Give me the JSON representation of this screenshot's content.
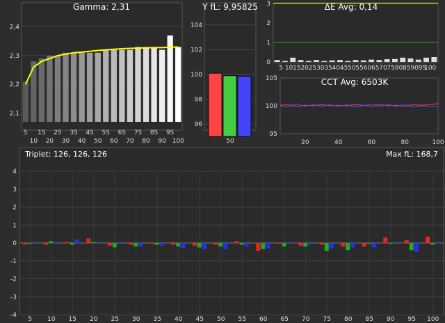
{
  "chart_data": [
    {
      "type": "bar",
      "title": "Gamma: 2,31",
      "categories": [
        5,
        10,
        15,
        20,
        25,
        30,
        35,
        40,
        45,
        50,
        55,
        60,
        65,
        70,
        75,
        80,
        85,
        90,
        95,
        100
      ],
      "x_tick_labels": [
        "5",
        "10",
        "15",
        "20",
        "25",
        "30",
        "35",
        "40",
        "45",
        "50",
        "55",
        "60",
        "65",
        "70",
        "75",
        "80",
        "85",
        "90",
        "95",
        "100"
      ],
      "y_tick_labels": [
        "2,4",
        "2,3",
        "2,2",
        "2,1"
      ],
      "y_ticks": [
        2.4,
        2.3,
        2.2,
        2.1
      ],
      "ylim": [
        2.07,
        2.44
      ],
      "values": [
        2.21,
        2.28,
        2.29,
        2.3,
        2.3,
        2.31,
        2.31,
        2.31,
        2.31,
        2.31,
        2.32,
        2.32,
        2.32,
        2.32,
        2.33,
        2.33,
        2.33,
        2.32,
        2.37,
        2.33
      ],
      "line_values": [
        2.2,
        2.26,
        2.28,
        2.29,
        2.3,
        2.305,
        2.31,
        2.312,
        2.315,
        2.318,
        2.32,
        2.322,
        2.324,
        2.325,
        2.326,
        2.327,
        2.328,
        2.328,
        2.329,
        2.33
      ],
      "line_color": "#ffff00"
    },
    {
      "type": "bar",
      "title": "Y fL: 9,95825",
      "categories": [
        "50"
      ],
      "x_tick_labels": [
        "50"
      ],
      "y_tick_labels": [
        "104",
        "102",
        "100",
        "98",
        "96"
      ],
      "y_ticks": [
        104,
        102,
        100,
        98,
        96
      ],
      "ylim": [
        95,
        105
      ],
      "series": [
        {
          "values": [
            100.1
          ],
          "color": "#ff4444"
        },
        {
          "values": [
            99.9
          ],
          "color": "#44cc44"
        },
        {
          "values": [
            99.85
          ],
          "color": "#4444ff"
        }
      ]
    },
    {
      "type": "bar",
      "title": "ΔE Avg: 0,14",
      "categories": [
        0,
        5,
        10,
        15,
        20,
        25,
        30,
        35,
        40,
        45,
        50,
        55,
        60,
        65,
        70,
        75,
        80,
        85,
        90,
        95,
        100
      ],
      "x_tick_labels": [
        "5",
        "10",
        "15",
        "20",
        "25",
        "30",
        "35",
        "40",
        "45",
        "50",
        "55",
        "60",
        "65",
        "70",
        "75",
        "80",
        "85",
        "90",
        "95",
        "100"
      ],
      "y_tick_labels": [
        "3",
        "2",
        "1",
        "0"
      ],
      "y_ticks": [
        3,
        2,
        1,
        0
      ],
      "ylim": [
        0,
        3
      ],
      "values": [
        0.1,
        0.05,
        0.22,
        0.1,
        0.05,
        0.1,
        0.05,
        0.08,
        0.1,
        0.05,
        0.1,
        0.08,
        0.12,
        0.1,
        0.14,
        0.15,
        0.22,
        0.18,
        0.12,
        0.22,
        0.25
      ],
      "reference_lines": [
        {
          "y": 3,
          "color": "#ffff00"
        },
        {
          "y": 1,
          "color": "#22aa22"
        }
      ]
    },
    {
      "type": "line",
      "title": "CCT Avg: 6503K",
      "x_tick_labels": [
        "20",
        "40",
        "60",
        "80",
        "100"
      ],
      "x_ticks": [
        20,
        40,
        60,
        80,
        100
      ],
      "xlim": [
        5,
        100
      ],
      "y_tick_labels": [
        "105",
        "100",
        "95"
      ],
      "y_ticks": [
        105,
        100,
        95
      ],
      "ylim": [
        95,
        105
      ],
      "x": [
        5,
        10,
        15,
        20,
        25,
        30,
        35,
        40,
        45,
        50,
        55,
        60,
        65,
        70,
        75,
        80,
        85,
        90,
        95,
        100
      ],
      "series": [
        {
          "color": "#ff3333",
          "values": [
            100.1,
            100.2,
            99.9,
            100.1,
            100.0,
            100.2,
            100.0,
            100.1,
            100.0,
            100.2,
            100.1,
            99.9,
            100.2,
            100.0,
            100.1,
            99.9,
            100.2,
            100.1,
            100.2,
            100.4
          ]
        },
        {
          "color": "#3355ff",
          "values": [
            100.0,
            99.8,
            100.3,
            99.9,
            100.2,
            99.9,
            100.2,
            99.9,
            100.2,
            99.8,
            100.0,
            100.3,
            99.9,
            100.2,
            99.9,
            100.2,
            99.8,
            100.0,
            99.9,
            99.9
          ]
        }
      ]
    },
    {
      "type": "bar",
      "title": "Triplet: 126, 126, 126",
      "subtitle": "Max fL: 168,7",
      "categories": [
        5,
        10,
        15,
        20,
        25,
        30,
        35,
        40,
        45,
        50,
        55,
        60,
        65,
        70,
        75,
        80,
        85,
        90,
        95,
        100
      ],
      "x_tick_labels": [
        "5",
        "10",
        "15",
        "20",
        "25",
        "30",
        "35",
        "40",
        "45",
        "50",
        "55",
        "60",
        "65",
        "70",
        "75",
        "80",
        "85",
        "90",
        "95",
        "100"
      ],
      "y_tick_labels": [
        "4",
        "3",
        "2",
        "1",
        "0",
        "-1",
        "-2",
        "-3",
        "-4"
      ],
      "y_ticks": [
        4,
        3,
        2,
        1,
        0,
        -1,
        -2,
        -3,
        -4
      ],
      "ylim": [
        -4,
        4
      ],
      "series": [
        {
          "color": "#ee2222",
          "values": [
            -0.1,
            -0.1,
            0.05,
            0.25,
            -0.15,
            -0.1,
            -0.05,
            -0.1,
            -0.15,
            -0.1,
            0.1,
            -0.45,
            -0.05,
            -0.15,
            -0.1,
            -0.2,
            -0.2,
            0.3,
            0.15,
            0.35
          ]
        },
        {
          "color": "#22aa22",
          "values": [
            -0.05,
            0.1,
            -0.1,
            0.05,
            -0.25,
            -0.2,
            -0.1,
            -0.2,
            -0.25,
            -0.2,
            -0.1,
            -0.35,
            -0.2,
            -0.2,
            -0.45,
            -0.4,
            -0.05,
            -0.05,
            -0.4,
            -0.1
          ]
        },
        {
          "color": "#2233ee",
          "values": [
            0.0,
            -0.05,
            0.2,
            -0.05,
            -0.05,
            -0.2,
            -0.15,
            -0.3,
            -0.35,
            -0.35,
            -0.2,
            -0.3,
            0.0,
            -0.1,
            -0.3,
            -0.25,
            -0.25,
            -0.05,
            -0.5,
            0.0
          ]
        }
      ]
    }
  ]
}
